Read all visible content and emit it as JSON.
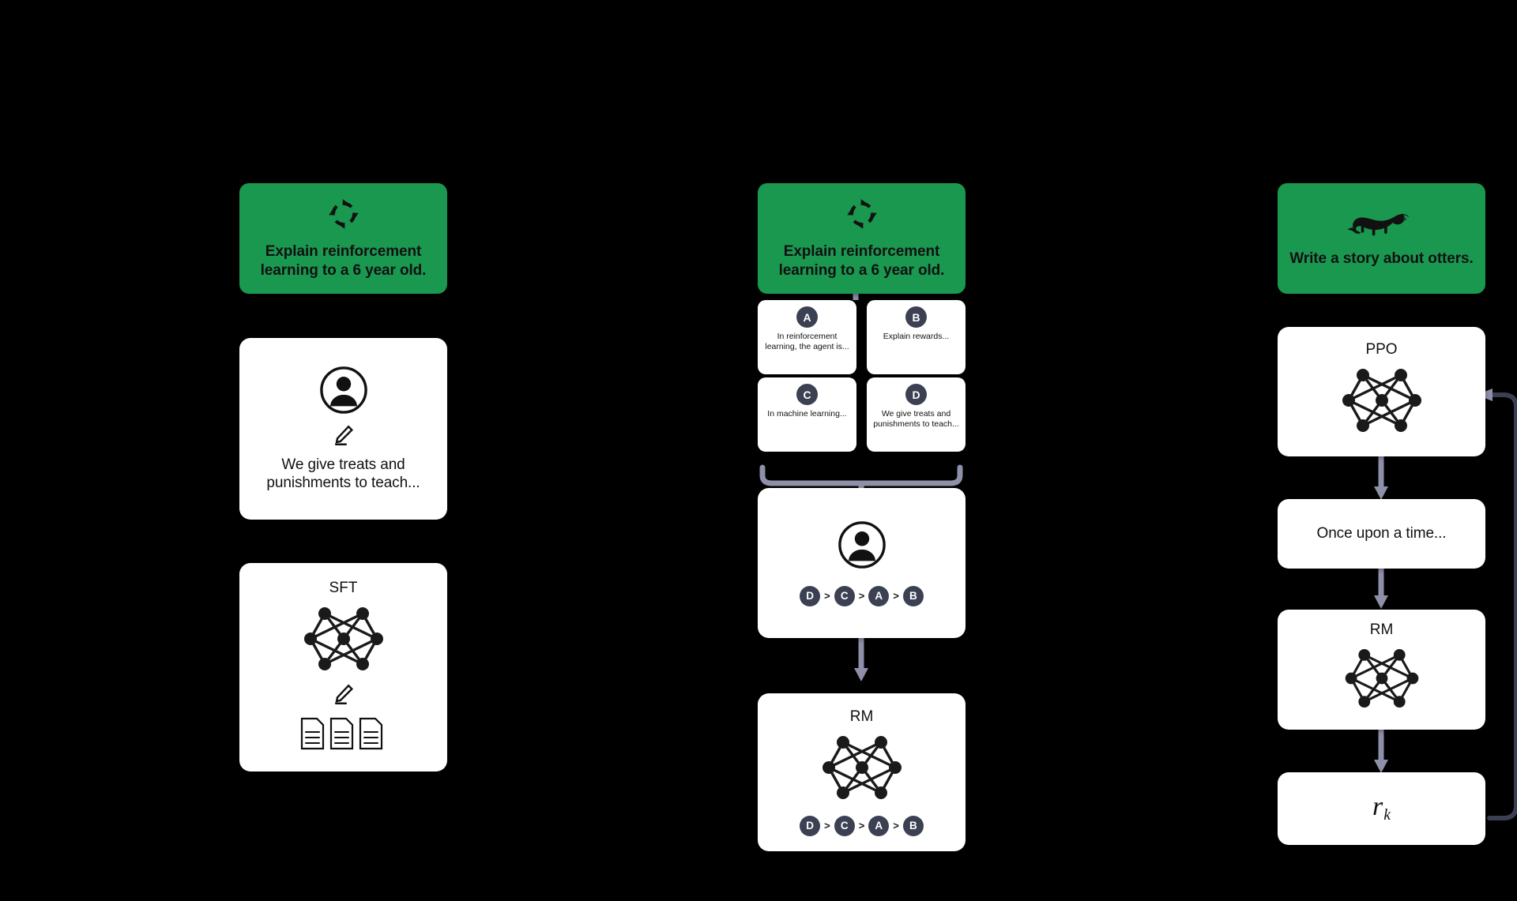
{
  "diagram": {
    "title": "RLHF three-stage pipeline",
    "colors": {
      "background": "#000000",
      "prompt_green": "#1a9850",
      "card_white": "#ffffff",
      "badge_navy": "#3b4152",
      "arrow_gray": "#8d90a8",
      "loop_line": "#3b3f52",
      "text_dark": "#111111"
    }
  },
  "step1": {
    "prompt": {
      "icon": "cycle-icon",
      "text": "Explain reinforcement learning to a 6 year old."
    },
    "human": {
      "person_icon": "person-icon",
      "pencil_icon": "pencil-icon",
      "text": "We give treats and punishments to teach..."
    },
    "model": {
      "label": "SFT",
      "net_icon": "neural-network-icon",
      "pencil_icon": "pencil-icon",
      "docs_icon": "documents-icon"
    }
  },
  "step2": {
    "prompt": {
      "icon": "cycle-icon",
      "text": "Explain reinforcement learning to a 6 year old."
    },
    "responses": [
      {
        "id": "A",
        "text": "In reinforcement learning, the agent is..."
      },
      {
        "id": "B",
        "text": "Explain rewards..."
      },
      {
        "id": "C",
        "text": "In machine learning..."
      },
      {
        "id": "D",
        "text": "We give treats and punishments to teach..."
      }
    ],
    "human_rank": {
      "person_icon": "person-icon",
      "ranking": [
        "D",
        "C",
        "A",
        "B"
      ],
      "separator": ">"
    },
    "model": {
      "label": "RM",
      "net_icon": "neural-network-icon",
      "ranking": [
        "D",
        "C",
        "A",
        "B"
      ],
      "separator": ">"
    }
  },
  "step3": {
    "prompt": {
      "icon": "otter-icon",
      "text": "Write a story about otters."
    },
    "policy": {
      "label": "PPO",
      "net_icon": "neural-network-icon"
    },
    "generation": {
      "text": "Once upon a time..."
    },
    "reward_model": {
      "label": "RM",
      "net_icon": "neural-network-icon"
    },
    "reward": {
      "symbol": "r",
      "subscript": "k"
    }
  }
}
